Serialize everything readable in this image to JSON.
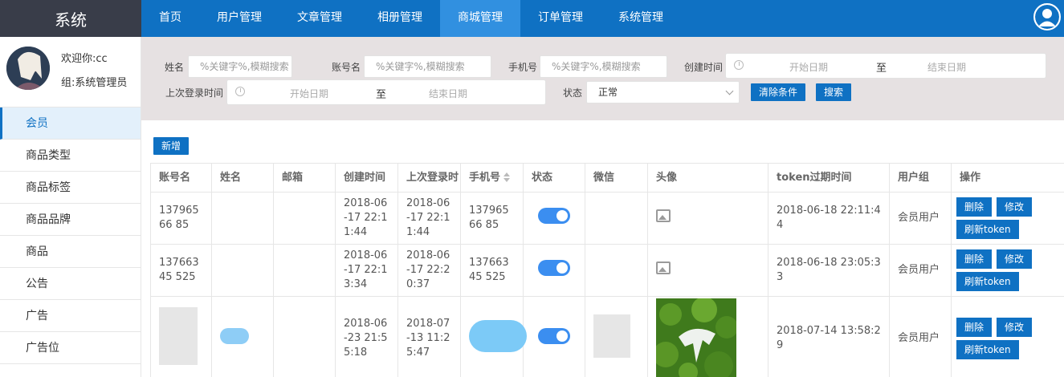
{
  "app": {
    "title": "系统"
  },
  "topnav": {
    "items": [
      {
        "label": "首页"
      },
      {
        "label": "用户管理"
      },
      {
        "label": "文章管理"
      },
      {
        "label": "相册管理"
      },
      {
        "label": "商城管理",
        "active": true
      },
      {
        "label": "订单管理"
      },
      {
        "label": "系统管理"
      }
    ],
    "user_icon": "user-avatar-icon"
  },
  "sidebar": {
    "welcome": "欢迎你:cc",
    "group": "组:系统管理员",
    "items": [
      {
        "label": "会员",
        "active": true
      },
      {
        "label": "商品类型"
      },
      {
        "label": "商品标签"
      },
      {
        "label": "商品品牌"
      },
      {
        "label": "商品"
      },
      {
        "label": "公告"
      },
      {
        "label": "广告"
      },
      {
        "label": "广告位"
      }
    ]
  },
  "filter": {
    "name_label": "姓名",
    "name_placeholder": "%关键字%,模糊搜索",
    "account_label": "账号名",
    "account_placeholder": "%关键字%,模糊搜索",
    "phone_label": "手机号",
    "phone_placeholder": "%关键字%,模糊搜索",
    "created_label": "创建时间",
    "created_start": "开始日期",
    "created_sep": "至",
    "created_end": "结束日期",
    "lastlogin_label": "上次登录时间",
    "lastlogin_start": "开始日期",
    "lastlogin_sep": "至",
    "lastlogin_end": "结束日期",
    "status_label": "状态",
    "status_value": "正常",
    "clear_button": "清除条件",
    "search_button": "搜索"
  },
  "table": {
    "add_button": "新增",
    "columns": [
      "账号名",
      "姓名",
      "邮箱",
      "创建时间",
      "上次登录时",
      "手机号",
      "状态",
      "微信",
      "头像",
      "token过期时间",
      "用户组",
      "操作"
    ],
    "rows": [
      {
        "account": "13796566 85",
        "name": "",
        "email": "",
        "created": "2018-06-17 22:11:44",
        "last_login": "2018-06-17 22:11:44",
        "phone": "13796566 85",
        "status_on": true,
        "wechat": "",
        "token_expire": "2018-06-18 22:11:44",
        "group": "会员用户"
      },
      {
        "account": "13766345 525",
        "name": "",
        "email": "",
        "created": "2018-06-17 22:13:34",
        "last_login": "2018-06-17 22:20:37",
        "phone": "13766345 525",
        "status_on": true,
        "wechat": "",
        "token_expire": "2018-06-18 23:05:33",
        "group": "会员用户"
      },
      {
        "account": "",
        "name": "",
        "email": "",
        "created": "2018-06-23 21:55:18",
        "last_login": "2018-07-13 11:25:47",
        "phone": "",
        "status_on": true,
        "wechat": "",
        "token_expire": "2018-07-14 13:58:29",
        "group": "会员用户"
      }
    ],
    "ops": {
      "delete": "删除",
      "edit": "修改",
      "refresh": "刷新token"
    }
  }
}
